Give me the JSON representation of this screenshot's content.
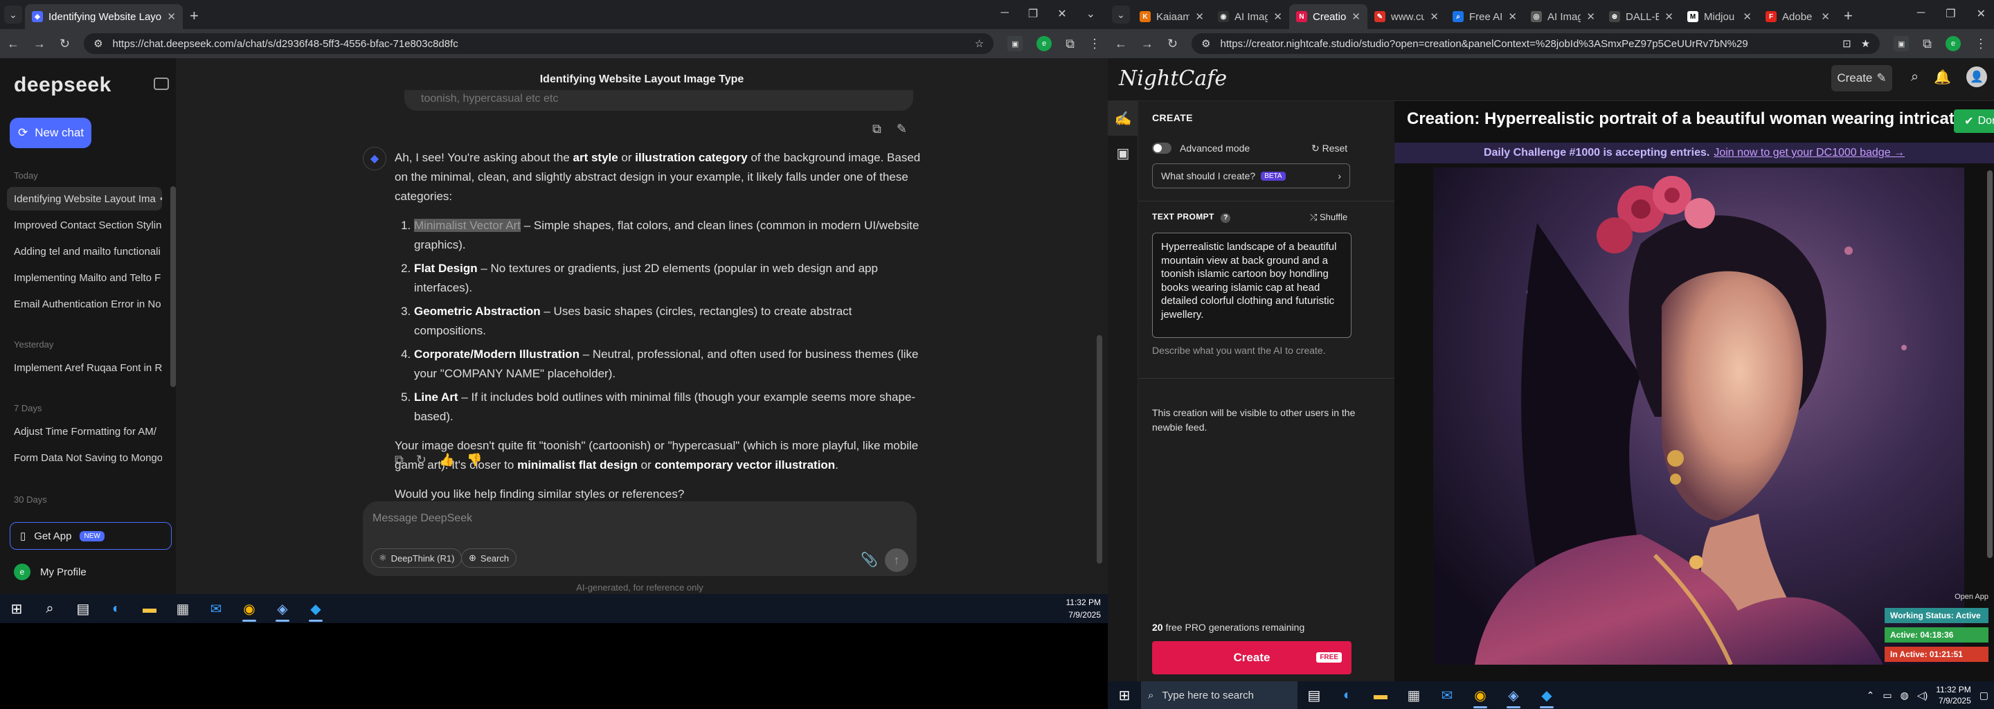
{
  "left_browser": {
    "tabs": [
      {
        "title": "Identifying Website Layout Ima",
        "active": true
      }
    ],
    "url": "https://chat.deepseek.com/a/chat/s/d2936f48-5ff3-4556-bfac-71e803c8d8fc",
    "profile_initial": "e"
  },
  "deepseek": {
    "logo": "deepseek",
    "new_chat": "New chat",
    "groups": {
      "today": "Today",
      "yesterday": "Yesterday",
      "days7": "7 Days",
      "days30": "30 Days"
    },
    "today_items": [
      "Identifying Website Layout Ima",
      "Improved Contact Section Styling",
      "Adding tel and mailto functionali",
      "Implementing Mailto and Telto F",
      "Email Authentication Error in No"
    ],
    "yesterday_items": [
      "Implement Aref Ruqaa Font in Re"
    ],
    "days7_items": [
      "Adjust Time Formatting for AM/",
      "Form Data Not Saving to Mongo"
    ],
    "get_app": "Get App",
    "get_app_badge": "NEW",
    "profile": "My Profile",
    "profile_initial": "e",
    "chat_title": "Identifying Website Layout Image Type",
    "prev_bubble_text": "toonish, hypercasual etc etc",
    "answer": {
      "intro_pre": "Ah, I see! You're asking about the ",
      "intro_b1": "art style",
      "intro_mid": " or ",
      "intro_b2": "illustration category",
      "intro_post": " of the background image. Based on the minimal, clean, and slightly abstract design in your example, it likely falls under one of these categories:",
      "items": [
        {
          "title": "Minimalist Vector Art",
          "text": " – Simple shapes, flat colors, and clean lines (common in modern UI/website graphics)."
        },
        {
          "title": "Flat Design",
          "text": " – No textures or gradients, just 2D elements (popular in web design and app interfaces)."
        },
        {
          "title": "Geometric Abstraction",
          "text": " – Uses basic shapes (circles, rectangles) to create abstract compositions."
        },
        {
          "title": "Corporate/Modern Illustration",
          "text": " – Neutral, professional, and often used for business themes (like your \"COMPANY NAME\" placeholder)."
        },
        {
          "title": "Line Art",
          "text": " – If it includes bold outlines with minimal fills (though your example seems more shape-based)."
        }
      ],
      "p2_pre": "Your image doesn't quite fit \"toonish\" (cartoonish) or \"hypercasual\" (which is more playful, like mobile game art). It's closer to ",
      "p2_b1": "minimalist flat design",
      "p2_mid": " or ",
      "p2_b2": "contemporary vector illustration",
      "p2_post": ".",
      "p3": "Would you like help finding similar styles or references?"
    },
    "input_placeholder": "Message DeepSeek",
    "deepthink": "DeepThink (R1)",
    "search": "Search",
    "footer": "AI-generated, for reference only"
  },
  "left_taskbar": {
    "time": "11:32 PM",
    "date": "7/9/2025"
  },
  "right_browser": {
    "tabs": [
      {
        "title": "Kaiaams",
        "color": "#e8710a",
        "glyph": "K"
      },
      {
        "title": "AI Imag",
        "color": "#e8e8e8",
        "glyph": "◉"
      },
      {
        "title": "Creation",
        "color": "#e0174a",
        "glyph": "N",
        "active": true
      },
      {
        "title": "www.cu",
        "color": "#d93025",
        "glyph": "✎"
      },
      {
        "title": "Free AI",
        "color": "#8ab4f8",
        "glyph": "⌕"
      },
      {
        "title": "AI Imag",
        "color": "#5a5a5a",
        "glyph": "◎"
      },
      {
        "title": "DALL-E",
        "color": "#444444",
        "glyph": "⊛"
      },
      {
        "title": "Midjou",
        "color": "#ffffff",
        "glyph": "M"
      },
      {
        "title": "Adobe",
        "color": "#e1251b",
        "glyph": "F"
      }
    ],
    "url": "https://creator.nightcafe.studio/studio?open=creation&panelContext=%28jobId%3ASmxPeZ97p5CeUUrRv7bN%29"
  },
  "nightcafe": {
    "logo": "NightCafe",
    "create_top": "Create",
    "panel_heading": "CREATE",
    "advanced_mode": "Advanced mode",
    "reset": "Reset",
    "what_should": "What should I create?",
    "beta": "BETA",
    "text_prompt": "TEXT PROMPT",
    "shuffle": "Shuffle",
    "prompt": "Hyperrealistic landscape of a beautiful mountain view at back ground and a toonish islamic cartoon boy hondling books wearing islamic cap at head  detailed colorful clothing and futuristic jewellery.",
    "prompt_help": "Describe what you want the AI to create.",
    "visibility_note": "This creation will be visible to other users in the newbie feed.",
    "gen_count": "20",
    "gen_label": "free PRO generations remaining",
    "create_button": "Create",
    "free_badge": "FREE",
    "creation_title": "Creation: Hyperrealistic portrait of a beautiful woman wearing intricately ...",
    "done": "Done",
    "banner_text": "Daily Challenge #1000 is accepting entries.",
    "banner_link": "Join now to get your DC1000 badge →",
    "open_app": "Open App",
    "status_working": "Working Status: Active",
    "status_active": "Active: 04:18:36",
    "status_inactive": "In Active: 01:21:51"
  },
  "right_taskbar": {
    "search_placeholder": "Type here to search",
    "time": "11:32 PM",
    "date": "7/9/2025"
  },
  "colors": {
    "accent_deepseek": "#4d6bfe",
    "accent_nightcafe": "#e0174a",
    "done_green": "#1fa84e"
  }
}
